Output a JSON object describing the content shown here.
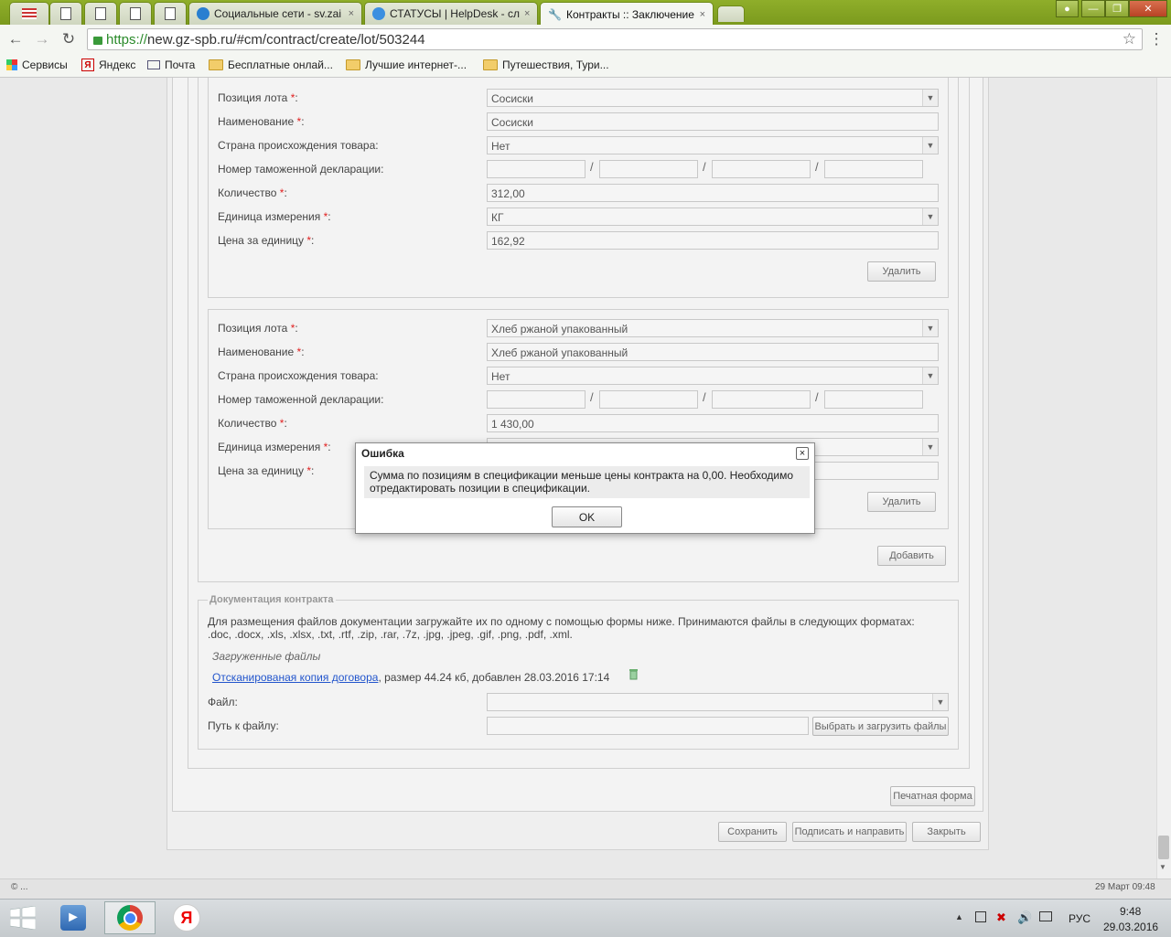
{
  "browser": {
    "tabs": [
      {
        "title": "Социальные сети - sv.zai",
        "close": "×"
      },
      {
        "title": "СТАТУСЫ | HelpDesk - сл",
        "close": "×"
      },
      {
        "title": "Контракты :: Заключение",
        "close": "×"
      }
    ],
    "url_scheme": "https://",
    "url_rest": "new.gz-spb.ru/#cm/contract/create/lot/503244",
    "bookmarks": [
      "Сервисы",
      "Яндекс",
      "Почта",
      "Бесплатные онлай...",
      "Лучшие интернет-...",
      "Путешествия, Тури..."
    ]
  },
  "positions": [
    {
      "lot_position_label": "Позиция лота",
      "lot_position_value": "Сосиски",
      "name_label": "Наименование",
      "name_value": "Сосиски",
      "country_label": "Страна происхождения товара:",
      "country_value": "Нет",
      "customs_label": "Номер таможенной декларации:",
      "quantity_label": "Количество",
      "quantity_value": "312,00",
      "unit_label": "Единица измерения",
      "unit_value": "КГ",
      "price_label": "Цена за единицу",
      "price_value": "162,92",
      "delete_label": "Удалить"
    },
    {
      "lot_position_label": "Позиция лота",
      "lot_position_value": "Хлеб ржаной упакованный",
      "name_label": "Наименование",
      "name_value": "Хлеб ржаной упакованный",
      "country_label": "Страна происхождения товара:",
      "country_value": "Нет",
      "customs_label": "Номер таможенной декларации:",
      "quantity_label": "Количество",
      "quantity_value": "1 430,00",
      "unit_label": "Единица измерения",
      "unit_value": "",
      "price_label": "Цена за единицу",
      "price_value": "",
      "delete_label": "Удалить"
    }
  ],
  "required_mark": "*",
  "colon": ":",
  "slash": "/",
  "add_label": "Добавить",
  "docs": {
    "title": "Документация контракта",
    "description": "Для размещения файлов документации загружайте их по одному с помощью формы ниже. Принимаются файлы в следующих форматах: .doc, .docx, .xls, .xlsx, .txt, .rtf, .zip, .rar, .7z, .jpg, .jpeg, .gif, .png, .pdf, .xml.",
    "uploaded_title": "Загруженные файлы",
    "file_link": "Отсканированая копия договора",
    "file_info": ", размер 44.24 кб, добавлен 28.03.2016 17:14",
    "file_label": "Файл:",
    "path_label": "Путь к файлу:",
    "upload_button": "Выбрать и загрузить файлы"
  },
  "print_button": "Печатная форма",
  "actions": {
    "save": "Сохранить",
    "sign": "Подписать и направить",
    "close": "Закрыть"
  },
  "modal": {
    "title": "Ошибка",
    "message": "Сумма по позициям в спецификации меньше цены контракта на 0,00. Необходимо отредактировать позиции в спецификации.",
    "ok": "OK",
    "close": "×"
  },
  "status": {
    "left": "© ...",
    "right": "29 Март 09:48"
  },
  "taskbar": {
    "lang": "РУС",
    "time": "9:48",
    "date": "29.03.2016",
    "yandex_glyph": "Я"
  }
}
